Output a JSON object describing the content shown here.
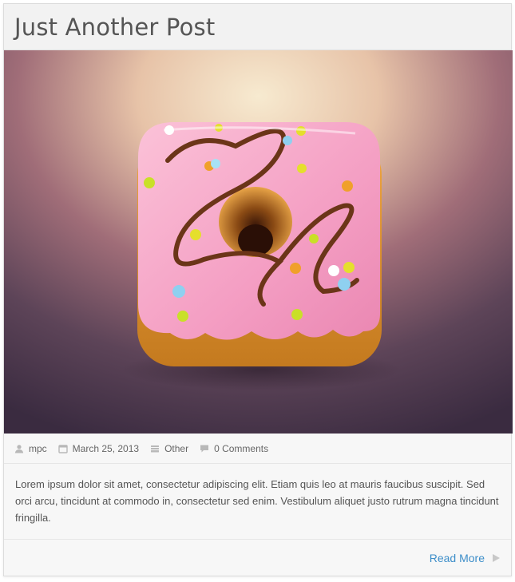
{
  "post": {
    "title": "Just Another Post",
    "meta": {
      "author": "mpc",
      "date": "March 25, 2013",
      "category": "Other",
      "comments": "0 Comments"
    },
    "excerpt": "Lorem ipsum dolor sit amet, consectetur adipiscing elit. Etiam quis leo at mauris faucibus suscipit. Sed orci arcu, tincidunt at commodo in, consectetur sed enim. Vestibulum aliquet justo rutrum magna tincidunt fringilla.",
    "read_more_label": "Read More"
  },
  "colors": {
    "accent": "#3d8ec9",
    "icing": "#f7a3c6",
    "dough": "#d98a2b",
    "background_top": "#f3dcbc",
    "background_bottom": "#3e2d42"
  },
  "icons": {
    "author": "user-icon",
    "date": "calendar-icon",
    "category": "folder-icon",
    "comments": "comment-icon",
    "read_more": "triangle-right-icon"
  }
}
